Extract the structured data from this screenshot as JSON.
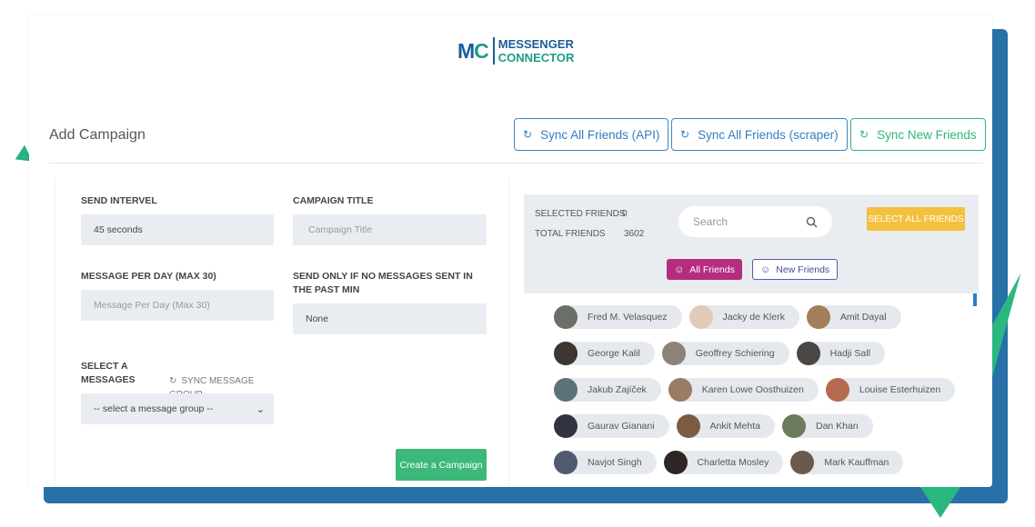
{
  "logo": {
    "mark_m": "M",
    "mark_c": "C",
    "line1": "MESSENGER",
    "line2": "CONNECTOR"
  },
  "header": {
    "title": "Add Campaign",
    "sync_buttons": [
      {
        "label": "Sync All Friends (API)",
        "icon": "sync-icon"
      },
      {
        "label": "Sync All Friends (scraper)",
        "icon": "sync-icon"
      },
      {
        "label": "Sync New Friends",
        "icon": "sync-icon"
      }
    ]
  },
  "form": {
    "send_interval": {
      "label": "SEND INTERVEL",
      "value": "45 seconds"
    },
    "campaign_title": {
      "label": "CAMPAIGN TITLE",
      "placeholder": "Campaign Title"
    },
    "message_per_day": {
      "label": "MESSAGE PER DAY (MAX 30)",
      "placeholder": "Message Per Day (Max 30)"
    },
    "send_only": {
      "label": "SEND ONLY IF NO MESSAGES SENT IN THE PAST MIN",
      "value": "None"
    },
    "select_messages": {
      "label": "SELECT A MESSAGES",
      "sync_label": "SYNC MESSAGE GROUP",
      "value": "-- select a message group --"
    },
    "create_button": "Create a Campaign"
  },
  "friends": {
    "selected_label": "SELECTED FRIENDS",
    "selected_value": "0",
    "total_label": "TOTAL FRIENDS",
    "total_value": "3602",
    "search_placeholder": "Search",
    "select_all": "SELECT ALL FRIENDS",
    "tabs": [
      {
        "label": "All Friends",
        "active": true
      },
      {
        "label": "New Friends",
        "active": false
      }
    ],
    "rows": [
      [
        "Fred M. Velasquez",
        "Jacky de Klerk",
        "Amit Dayal"
      ],
      [
        "George Kalil",
        "Geoffrey Schiering",
        "Hadji Sall"
      ],
      [
        "Jakub Zajíček",
        "Karen Lowe Oosthuizen",
        "Louise Esterhuizen"
      ],
      [
        "Gaurav Gianani",
        "Ankit Mehta",
        "Dan Khan"
      ],
      [
        "Navjot Singh",
        "Charletta Mosley",
        "Mark Kauffman"
      ]
    ]
  },
  "colors": {
    "brand_blue": "#1a5e9a",
    "brand_teal": "#1f9b8a",
    "primary": "#2f7fc3",
    "success": "#3cb878",
    "warning": "#f3c13e",
    "tab_active": "#b62c7f"
  }
}
